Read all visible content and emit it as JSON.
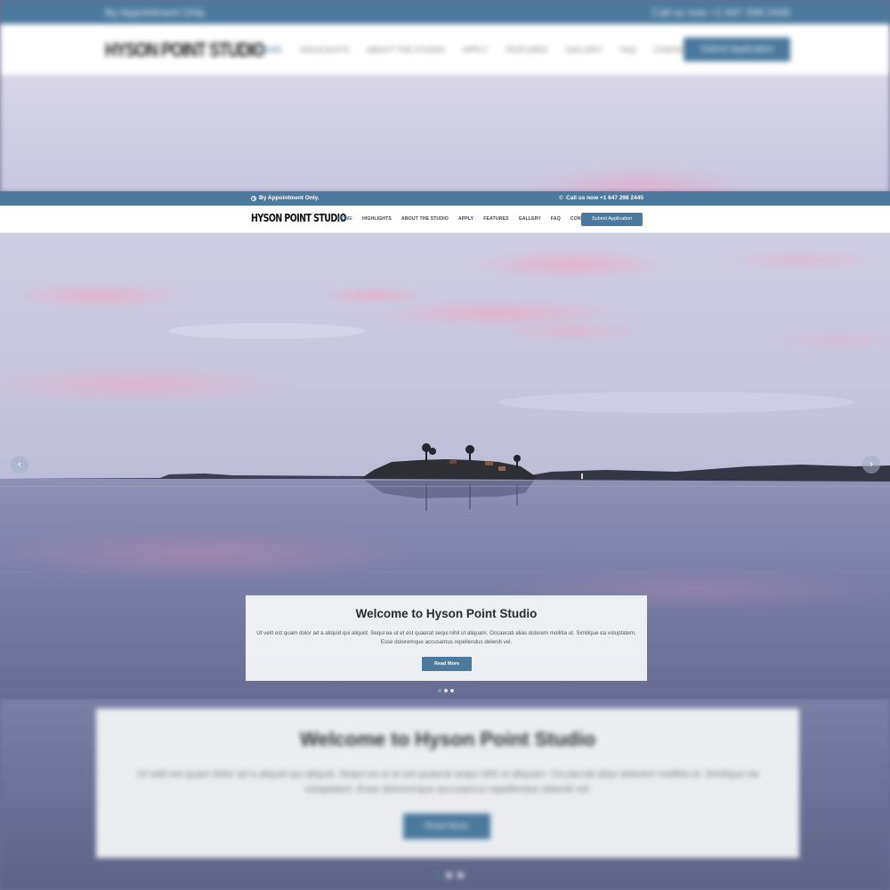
{
  "topbar": {
    "hours_text": "By Appointment Only.",
    "phone_text": "Call us now +1 647 298 2445"
  },
  "brand": {
    "logo_text": "HYSON POINT STUDIO",
    "accent_color": "#4b7a9e"
  },
  "nav": {
    "items": [
      {
        "label": "HOME",
        "active": true
      },
      {
        "label": "HIGHLIGHTS"
      },
      {
        "label": "ABOUT THE STUDIO"
      },
      {
        "label": "APPLY"
      },
      {
        "label": "FEATURES"
      },
      {
        "label": "GALLERY"
      },
      {
        "label": "FAQ"
      },
      {
        "label": "CONTACT"
      }
    ],
    "cta_label": "Submit Application"
  },
  "hero": {
    "title": "Welcome to Hyson Point Studio",
    "text": "Ut velit est quam dolor ad a aliquid qui aliquid. Sequi ea ut et est quaerat sequi nihil ut aliquam. Occaecati alias dolorem mollitia ut. Similique ea voluptatem. Esse doloremque accusamus repellendus deleniti vel.",
    "button_label": "Read More",
    "slides_count": 3,
    "active_slide": 1,
    "prev_icon": "chevron-left-icon",
    "next_icon": "chevron-right-icon"
  }
}
